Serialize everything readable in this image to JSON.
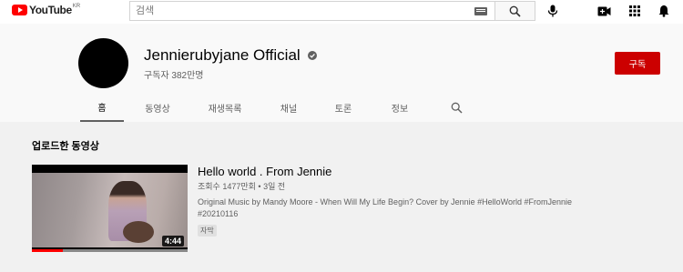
{
  "header": {
    "logo_text": "YouTube",
    "region": "KR",
    "search_placeholder": "검색",
    "icons": [
      "keyboard-icon",
      "search-icon",
      "mic-icon",
      "create-video-icon",
      "apps-icon",
      "notifications-icon"
    ]
  },
  "channel": {
    "name": "Jennierubyjane Official",
    "subscribers": "구독자 382만명",
    "subscribe_label": "구독",
    "verified": true
  },
  "tabs": [
    "홈",
    "동영상",
    "재생목록",
    "채널",
    "토론",
    "정보"
  ],
  "active_tab": "홈",
  "section": {
    "title": "업로드한 동영상"
  },
  "video": {
    "title": "Hello world . From Jennie",
    "meta": "조회수 1477만회 • 3일 전",
    "description": "Original Music by Mandy Moore - When Will My Life Begin? Cover by Jennie #HelloWorld #FromJennie #20210116",
    "duration": "4:44",
    "badge": "자막",
    "watch_progress": 0.2
  },
  "colors": {
    "brand_red": "#ff0000",
    "subscribe_red": "#cc0000",
    "page_bg": "#f1f1f1",
    "header_bg": "#f9f9f9"
  }
}
